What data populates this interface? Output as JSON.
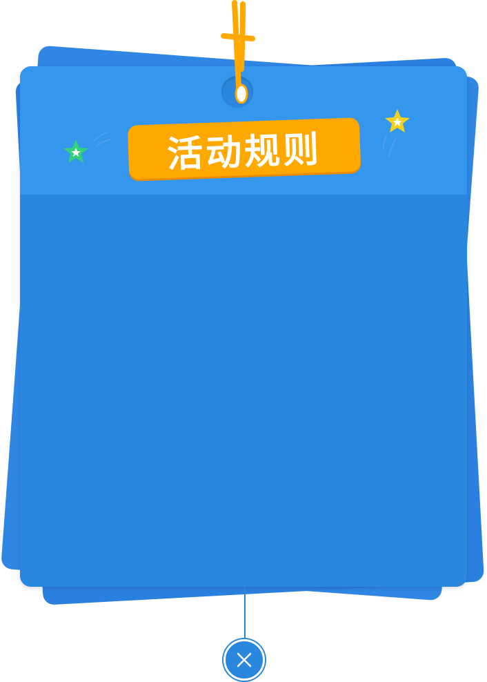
{
  "dialog": {
    "title": "活动规则"
  },
  "icons": {
    "close": "close-icon",
    "star_left": "star-icon",
    "star_right": "star-icon"
  },
  "colors": {
    "card_header": "#3596ee",
    "card_body": "#2a87de",
    "badge": "#ffa800",
    "string": "#ffa800",
    "star_left": "#34d17a",
    "star_right": "#f2d21f"
  }
}
